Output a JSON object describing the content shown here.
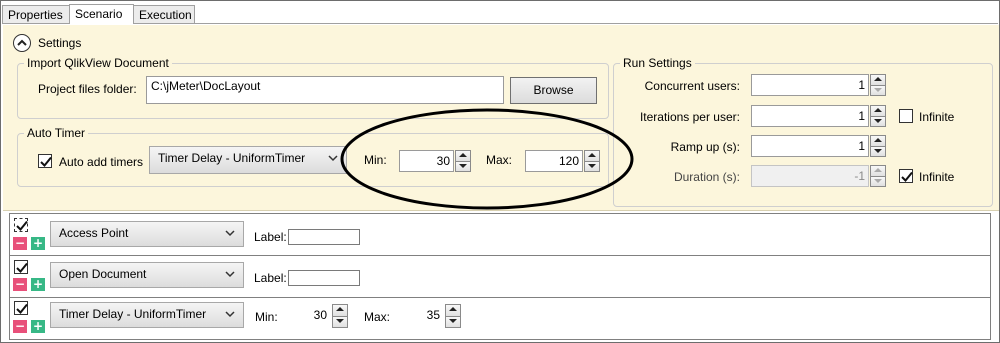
{
  "tabs": [
    {
      "label": "Properties",
      "active": false
    },
    {
      "label": "Scenario",
      "active": true
    },
    {
      "label": "Execution",
      "active": false
    }
  ],
  "settings": {
    "label": "Settings",
    "collapse_icon": "chevron-up-circle-icon",
    "import": {
      "title": "Import QlikView Document",
      "project_folder_label": "Project files folder:",
      "project_folder_value": "C:\\jMeter\\DocLayout",
      "browse_label": "Browse"
    },
    "auto_timer": {
      "title": "Auto Timer",
      "auto_add_label": "Auto add timers",
      "auto_add_checked": true,
      "timer_type": "Timer Delay - UniformTimer",
      "min_label": "Min:",
      "min_value": "30",
      "max_label": "Max:",
      "max_value": "120"
    },
    "run": {
      "title": "Run Settings",
      "concurrent_label": "Concurrent users:",
      "concurrent_value": "1",
      "iterations_label": "Iterations per user:",
      "iterations_value": "1",
      "iterations_infinite_label": "Infinite",
      "iterations_infinite_checked": false,
      "rampup_label": "Ramp up (s):",
      "rampup_value": "1",
      "duration_label": "Duration (s):",
      "duration_value": "-1",
      "duration_infinite_label": "Infinite",
      "duration_infinite_checked": true
    }
  },
  "actions": [
    {
      "type": "Access Point",
      "label_caption": "Label:",
      "label_value": "",
      "checked": true
    },
    {
      "type": "Open Document",
      "label_caption": "Label:",
      "label_value": "",
      "checked": true
    },
    {
      "type": "Timer Delay - UniformTimer",
      "min_label": "Min:",
      "min_value": "30",
      "max_label": "Max:",
      "max_value": "35",
      "checked": true
    }
  ],
  "colors": {
    "settings_background": "#fcf6dc",
    "remove_button": "#e8507a",
    "add_button": "#37b886"
  }
}
